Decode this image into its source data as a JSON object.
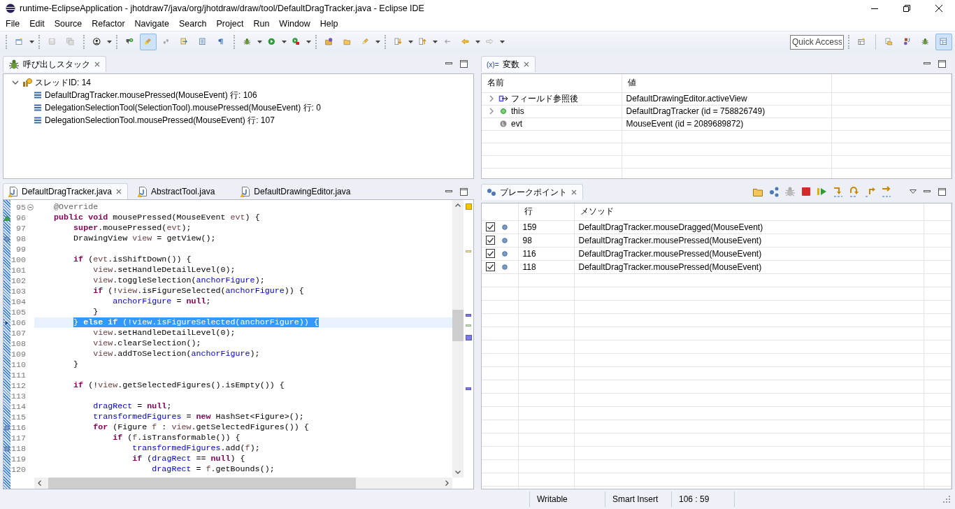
{
  "window": {
    "title": "runtime-EclipseApplication - jhotdraw7/java/org/jhotdraw/draw/tool/DefaultDragTracker.java - Eclipse IDE"
  },
  "menu": [
    "File",
    "Edit",
    "Source",
    "Refactor",
    "Navigate",
    "Search",
    "Project",
    "Run",
    "Window",
    "Help"
  ],
  "toolbar": {
    "toggle_buttons": [
      {
        "pressed": true
      }
    ],
    "quick_access": {
      "placeholder": "Quick Access"
    },
    "perspectives": [
      {
        "selected": false
      },
      {
        "selected": false
      },
      {
        "selected": false
      },
      {
        "selected": true
      }
    ]
  },
  "debug_view": {
    "tabs": [
      {
        "label": "呼び出しスタック",
        "selected": true
      }
    ],
    "tree": [
      {
        "label": "スレッドID: 14",
        "expanded": true,
        "children": [
          {
            "label": "DefaultDragTracker.mousePressed(MouseEvent) 行: 106"
          },
          {
            "label": "DelegationSelectionTool(SelectionTool).mousePressed(MouseEvent) 行: 0"
          },
          {
            "label": "DelegationSelectionTool.mousePressed(MouseEvent) 行: 107"
          }
        ]
      }
    ]
  },
  "variables_view": {
    "tabs": [
      {
        "icon_text": "(x)=",
        "label": "変数",
        "selected": true
      }
    ],
    "columns": [
      "名前",
      "値"
    ],
    "rows": [
      {
        "kind": "field-access",
        "name": "フィールド参照後",
        "value": "DefaultDrawingEditor.activeView",
        "expandable": true,
        "expanded": false
      },
      {
        "kind": "instance",
        "name": "this",
        "value": "DefaultDragTracker (id = 758826749)",
        "expandable": true,
        "expanded": false
      },
      {
        "kind": "local",
        "name": "evt",
        "value": "MouseEvent (id = 2089689872)",
        "expandable": false
      }
    ]
  },
  "editor": {
    "tabs": [
      {
        "label": "DefaultDragTracker.java",
        "selected": true
      },
      {
        "label": "AbstractTool.java",
        "selected": false
      },
      {
        "label": "DefaultDrawingEditor.java",
        "selected": false
      }
    ],
    "lines": [
      {
        "number": "95",
        "kind": "fold",
        "selected": false,
        "segments": [
          {
            "text": "    @Override",
            "kind": "ann"
          }
        ]
      },
      {
        "number": "96",
        "kind": "overrides",
        "selected": false,
        "segments": [
          {
            "text": "    public",
            "kind": "kw"
          },
          {
            "text": " void",
            "kind": "kw"
          },
          {
            "text": " mousePressed(MouseEvent ",
            "kind": "plain"
          },
          {
            "text": "evt",
            "kind": "local"
          },
          {
            "text": ") {",
            "kind": "plain"
          }
        ]
      },
      {
        "number": "97",
        "kind": "plain",
        "selected": false,
        "segments": [
          {
            "text": "        super",
            "kind": "kw"
          },
          {
            "text": ".mousePressed(",
            "kind": "plain"
          },
          {
            "text": "evt",
            "kind": "local"
          },
          {
            "text": ");",
            "kind": "plain"
          }
        ]
      },
      {
        "number": "98",
        "kind": "breakpoint",
        "selected": false,
        "segments": [
          {
            "text": "        DrawingView ",
            "kind": "plain"
          },
          {
            "text": "view",
            "kind": "local"
          },
          {
            "text": " = getView();",
            "kind": "plain"
          }
        ]
      },
      {
        "number": "99",
        "kind": "plain",
        "selected": false
      },
      {
        "number": "100",
        "kind": "plain",
        "selected": false,
        "segments": [
          {
            "text": "        if",
            "kind": "kw"
          },
          {
            "text": " (",
            "kind": "plain"
          },
          {
            "text": "evt",
            "kind": "local"
          },
          {
            "text": ".isShiftDown()) {",
            "kind": "plain"
          }
        ]
      },
      {
        "number": "101",
        "kind": "plain",
        "selected": false,
        "segments": [
          {
            "text": "            view",
            "kind": "local"
          },
          {
            "text": ".setHandleDetailLevel(0);",
            "kind": "plain"
          }
        ]
      },
      {
        "number": "102",
        "kind": "plain",
        "selected": false,
        "segments": [
          {
            "text": "            view",
            "kind": "local"
          },
          {
            "text": ".toggleSelection(",
            "kind": "plain"
          },
          {
            "text": "anchorFigure",
            "kind": "field"
          },
          {
            "text": ");",
            "kind": "plain"
          }
        ]
      },
      {
        "number": "103",
        "kind": "plain",
        "selected": false,
        "segments": [
          {
            "text": "            if",
            "kind": "kw"
          },
          {
            "text": " (!",
            "kind": "plain"
          },
          {
            "text": "view",
            "kind": "local"
          },
          {
            "text": ".isFigureSelected(",
            "kind": "plain"
          },
          {
            "text": "anchorFigure",
            "kind": "field"
          },
          {
            "text": ")) {",
            "kind": "plain"
          }
        ]
      },
      {
        "number": "104",
        "kind": "plain",
        "selected": false,
        "segments": [
          {
            "text": "                anchorFigure",
            "kind": "field"
          },
          {
            "text": " = ",
            "kind": "plain"
          },
          {
            "text": "null",
            "kind": "kw"
          },
          {
            "text": ";",
            "kind": "plain"
          }
        ]
      },
      {
        "number": "105",
        "kind": "plain",
        "selected": false,
        "segments": [
          {
            "text": "            }",
            "kind": "plain"
          }
        ]
      },
      {
        "number": "106",
        "kind": "instruction-pointer",
        "selected": true,
        "segments": [
          {
            "text": "        } ",
            "kind": "plain"
          },
          {
            "text": "else",
            "kind": "kw"
          },
          {
            "text": " if",
            "kind": "kw"
          },
          {
            "text": " (!",
            "kind": "plain"
          },
          {
            "text": "view",
            "kind": "local"
          },
          {
            "text": ".isFigureSelected(",
            "kind": "plain"
          },
          {
            "text": "anchorFigure",
            "kind": "field"
          },
          {
            "text": ")) {",
            "kind": "plain"
          }
        ]
      },
      {
        "number": "107",
        "kind": "plain",
        "selected": false,
        "segments": [
          {
            "text": "            view",
            "kind": "local"
          },
          {
            "text": ".setHandleDetailLevel(0);",
            "kind": "plain"
          }
        ]
      },
      {
        "number": "108",
        "kind": "plain",
        "selected": false,
        "segments": [
          {
            "text": "            view",
            "kind": "local"
          },
          {
            "text": ".clearSelection();",
            "kind": "plain"
          }
        ]
      },
      {
        "number": "109",
        "kind": "plain",
        "selected": false,
        "segments": [
          {
            "text": "            view",
            "kind": "local"
          },
          {
            "text": ".addToSelection(",
            "kind": "plain"
          },
          {
            "text": "anchorFigure",
            "kind": "field"
          },
          {
            "text": ");",
            "kind": "plain"
          }
        ]
      },
      {
        "number": "110",
        "kind": "plain",
        "selected": false,
        "segments": [
          {
            "text": "        }",
            "kind": "plain"
          }
        ]
      },
      {
        "number": "111",
        "kind": "plain",
        "selected": false
      },
      {
        "number": "112",
        "kind": "plain",
        "selected": false,
        "segments": [
          {
            "text": "        if",
            "kind": "kw"
          },
          {
            "text": " (!",
            "kind": "plain"
          },
          {
            "text": "view",
            "kind": "local"
          },
          {
            "text": ".getSelectedFigures().isEmpty()) {",
            "kind": "plain"
          }
        ]
      },
      {
        "number": "113",
        "kind": "plain",
        "selected": false
      },
      {
        "number": "114",
        "kind": "plain",
        "selected": false,
        "segments": [
          {
            "text": "            dragRect",
            "kind": "field"
          },
          {
            "text": " = ",
            "kind": "plain"
          },
          {
            "text": "null",
            "kind": "kw"
          },
          {
            "text": ";",
            "kind": "plain"
          }
        ]
      },
      {
        "number": "115",
        "kind": "plain",
        "selected": false,
        "segments": [
          {
            "text": "            transformedFigures",
            "kind": "field"
          },
          {
            "text": " = ",
            "kind": "plain"
          },
          {
            "text": "new",
            "kind": "kw"
          },
          {
            "text": " HashSet<Figure>();",
            "kind": "plain"
          }
        ]
      },
      {
        "number": "116",
        "kind": "breakpoint",
        "selected": false,
        "segments": [
          {
            "text": "            for",
            "kind": "kw"
          },
          {
            "text": " (Figure ",
            "kind": "plain"
          },
          {
            "text": "f",
            "kind": "local"
          },
          {
            "text": " : ",
            "kind": "plain"
          },
          {
            "text": "view",
            "kind": "local"
          },
          {
            "text": ".getSelectedFigures()) {",
            "kind": "plain"
          }
        ]
      },
      {
        "number": "117",
        "kind": "plain",
        "selected": false,
        "segments": [
          {
            "text": "                if",
            "kind": "kw"
          },
          {
            "text": " (",
            "kind": "plain"
          },
          {
            "text": "f",
            "kind": "local"
          },
          {
            "text": ".isTransformable()) {",
            "kind": "plain"
          }
        ]
      },
      {
        "number": "118",
        "kind": "breakpoint",
        "selected": false,
        "segments": [
          {
            "text": "                    transformedFigures",
            "kind": "field"
          },
          {
            "text": ".add(",
            "kind": "plain"
          },
          {
            "text": "f",
            "kind": "local"
          },
          {
            "text": ");",
            "kind": "plain"
          }
        ]
      },
      {
        "number": "119",
        "kind": "plain",
        "selected": false,
        "segments": [
          {
            "text": "                    if",
            "kind": "kw"
          },
          {
            "text": " (",
            "kind": "plain"
          },
          {
            "text": "dragRect",
            "kind": "field"
          },
          {
            "text": " == ",
            "kind": "plain"
          },
          {
            "text": "null",
            "kind": "kw"
          },
          {
            "text": ") {",
            "kind": "plain"
          }
        ]
      },
      {
        "number": "120",
        "kind": "plain",
        "selected": false,
        "segments": [
          {
            "text": "                        dragRect",
            "kind": "field"
          },
          {
            "text": " = ",
            "kind": "plain"
          },
          {
            "text": "f",
            "kind": "local"
          },
          {
            "text": ".getBounds();",
            "kind": "plain"
          }
        ]
      }
    ]
  },
  "breakpoints_view": {
    "tabs": [
      {
        "label": "ブレークポイント",
        "selected": true
      }
    ],
    "columns": [
      "行",
      "メソッド"
    ],
    "rows": [
      {
        "checked": true,
        "line": "159",
        "method": "DefaultDragTracker.mouseDragged(MouseEvent)"
      },
      {
        "checked": true,
        "line": "98",
        "method": "DefaultDragTracker.mousePressed(MouseEvent)"
      },
      {
        "checked": true,
        "line": "116",
        "method": "DefaultDragTracker.mousePressed(MouseEvent)"
      },
      {
        "checked": true,
        "line": "118",
        "method": "DefaultDragTracker.mousePressed(MouseEvent)"
      }
    ]
  },
  "status_bar": {
    "items": [
      "Writable",
      "Smart Insert",
      "106 : 59"
    ]
  }
}
